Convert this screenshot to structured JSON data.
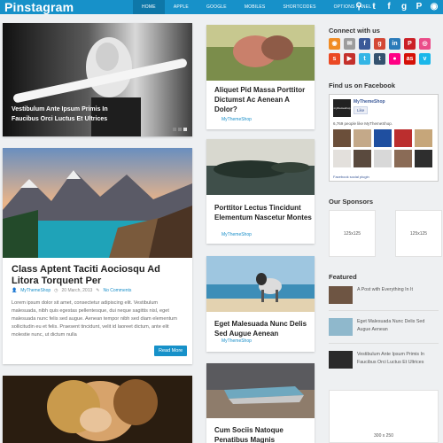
{
  "header": {
    "logo": "Pinstagram",
    "nav": [
      "HOME",
      "APPLE",
      "GOOGLE",
      "MOBILES",
      "SHORTCODES",
      "OPTIONS PANEL ▾"
    ],
    "icons": [
      "search-icon",
      "twitter-icon",
      "facebook-icon",
      "google-plus-icon",
      "pinterest-icon",
      "rss-icon"
    ]
  },
  "posts": {
    "featured_slider": {
      "title": "Vestibulum Ante Ipsum Primis In Faucibus Orci Luctus Et Ultrices"
    },
    "main_post": {
      "title": "Class Aptent Taciti Aociosqu Ad Litora Torquent Per",
      "author": "MyThemeShop",
      "date": "20 March, 2013",
      "comments": "No Comments",
      "excerpt": "Lorem ipsum dolor sit amet, consectetur adipiscing elit. Vestibulum malesuada, nibh quis egestas pellentesque, dui neque sagittis nisl, eget malesuada nunc felis sed augue. Aenean tempor nibh sed diam elementum sollicitudin eu et felis. Praesent tincidunt, velit id laoreet dictum, ante elit molestie nunc, ut dictum nulla",
      "read_more": "Read More"
    },
    "col2": [
      {
        "title": "Aliquet Pid Massa Porttitor Dictumst Ac Aenean A Dolor?",
        "author": "MyThemeShop"
      },
      {
        "title": "Porttitor Lectus Tincidunt Elementum Nascetur Montes",
        "author": "MyThemeShop"
      },
      {
        "title": "Eget Malesuada Nunc Delis Sed Augue Aenean",
        "author": "MyThemeShop"
      },
      {
        "title": "Cum Sociis Natoque Penatibus Magnis",
        "author": ""
      }
    ]
  },
  "sidebar": {
    "connect_heading": "Connect with us",
    "connect_icons": [
      {
        "name": "rss-icon",
        "glyph": "◉",
        "color": "#f08c24"
      },
      {
        "name": "email-icon",
        "glyph": "✉",
        "color": "#9c9c9c"
      },
      {
        "name": "facebook-icon",
        "glyph": "f",
        "color": "#3b5998"
      },
      {
        "name": "google-plus-icon",
        "glyph": "g",
        "color": "#d34836"
      },
      {
        "name": "linkedin-icon",
        "glyph": "in",
        "color": "#2b7bb9"
      },
      {
        "name": "pinterest-icon",
        "glyph": "P",
        "color": "#cb2027"
      },
      {
        "name": "dribbble-icon",
        "glyph": "◎",
        "color": "#ea4c89"
      },
      {
        "name": "stumbleupon-icon",
        "glyph": "s",
        "color": "#eb4924"
      },
      {
        "name": "youtube-icon",
        "glyph": "▶",
        "color": "#c4302b"
      },
      {
        "name": "twitter-icon",
        "glyph": "t",
        "color": "#33b5e5"
      },
      {
        "name": "tumblr-icon",
        "glyph": "t",
        "color": "#34526f"
      },
      {
        "name": "flickr-icon",
        "glyph": "●",
        "color": "#ff0084"
      },
      {
        "name": "lastfm-icon",
        "glyph": "as",
        "color": "#d51007"
      },
      {
        "name": "vimeo-icon",
        "glyph": "v",
        "color": "#1ab7ea"
      }
    ],
    "facebook_heading": "Find us on Facebook",
    "facebook": {
      "logo_text": "mythemeshop",
      "page_name": "MyThemeShop",
      "like": "Like",
      "like_count": "6,769 people like MyThemeShop.",
      "plugin": "Facebook social plugin"
    },
    "sponsors_heading": "Our Sponsors",
    "sponsors": [
      "125x125",
      "125x125"
    ],
    "featured_heading": "Featured",
    "featured": [
      {
        "title": "A Post with Everything In It"
      },
      {
        "title": "Eget Malesuada Nunc Delis Sed Augue Aenean"
      },
      {
        "title": "Vestibulum Ante Ipsum Primis In Faucibus Orci Luctus Et Ultrices"
      }
    ],
    "ad_bottom": "300 x 250"
  }
}
